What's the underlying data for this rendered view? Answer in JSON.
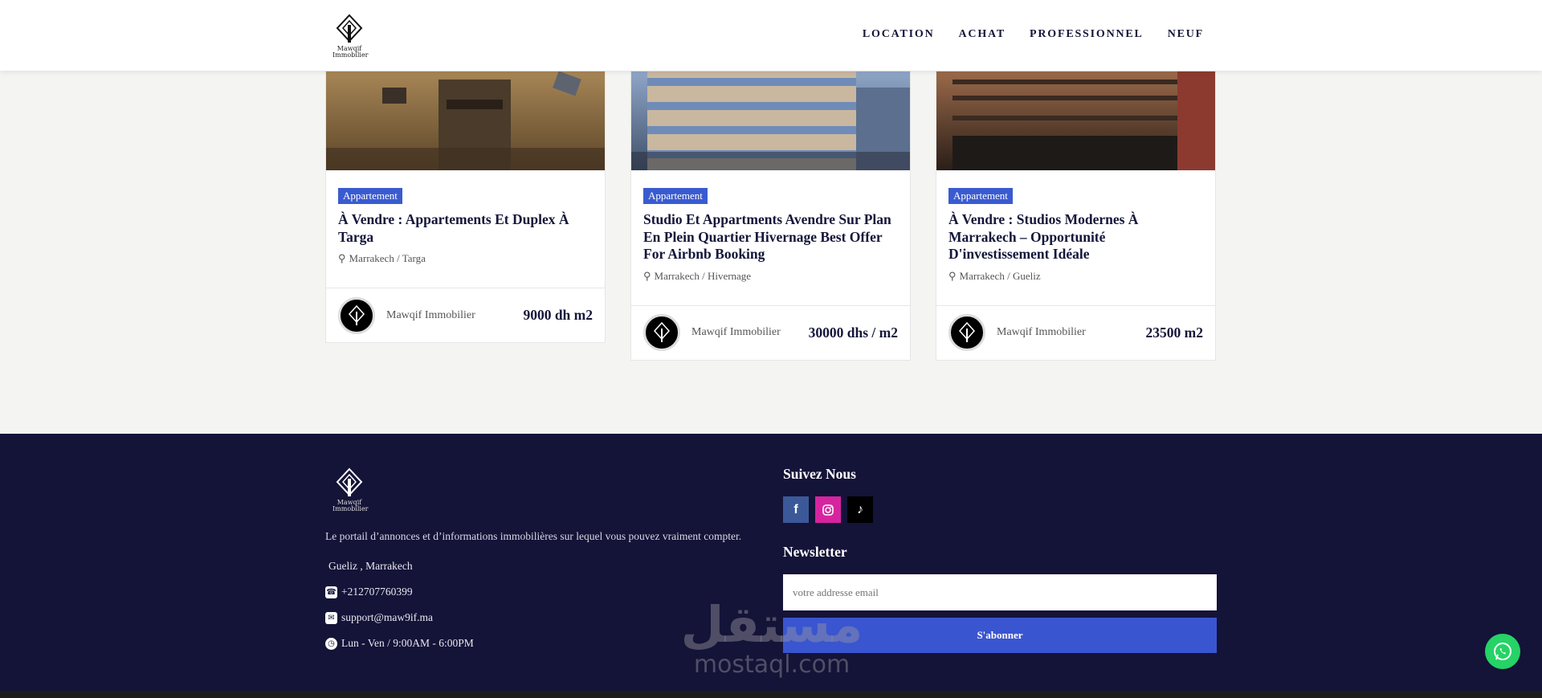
{
  "header": {
    "logo_text": "Mawqif Immobilier",
    "nav": [
      "LOCATION",
      "ACHAT",
      "PROFESSIONNEL",
      "NEUF"
    ]
  },
  "listings": [
    {
      "badge": "Appartement",
      "title": "À Vendre : Appartements Et Duplex À Targa",
      "location": "Marrakech / Targa",
      "agent": "Mawqif Immobilier",
      "price": "9000 dh m2"
    },
    {
      "badge": "Appartement",
      "title": "Studio Et Appartments Avendre Sur Plan En Plein Quartier Hivernage Best Offer For Airbnb Booking",
      "location": "Marrakech / Hivernage",
      "agent": "Mawqif Immobilier",
      "price": "30000 dhs / m2"
    },
    {
      "badge": "Appartement",
      "title": "À Vendre : Studios Modernes À Marrakech – Opportunité D'investissement Idéale",
      "location": "Marrakech / Gueliz",
      "agent": "Mawqif Immobilier",
      "price": "23500 m2"
    }
  ],
  "footer": {
    "logo_text": "Mawqif Immobilier",
    "description": "Le portail d’annonces et d’informations immobilières sur lequel vous pouvez vraiment compter.",
    "address": "Gueliz , Marrakech",
    "phone": "+212707760399",
    "email": "support@maw9if.ma",
    "hours": "Lun - Ven / 9:00AM - 6:00PM",
    "follow_heading": "Suivez Nous",
    "newsletter_heading": "Newsletter",
    "email_placeholder": "votre addresse email",
    "subscribe_label": "S'abonner"
  },
  "watermark": {
    "arabic": "مستقل",
    "latin": "mostaql.com"
  },
  "colors": {
    "accent": "#3a5bd0",
    "navy": "#14163a",
    "footer_bg": "#141338",
    "whatsapp": "#25d366"
  }
}
